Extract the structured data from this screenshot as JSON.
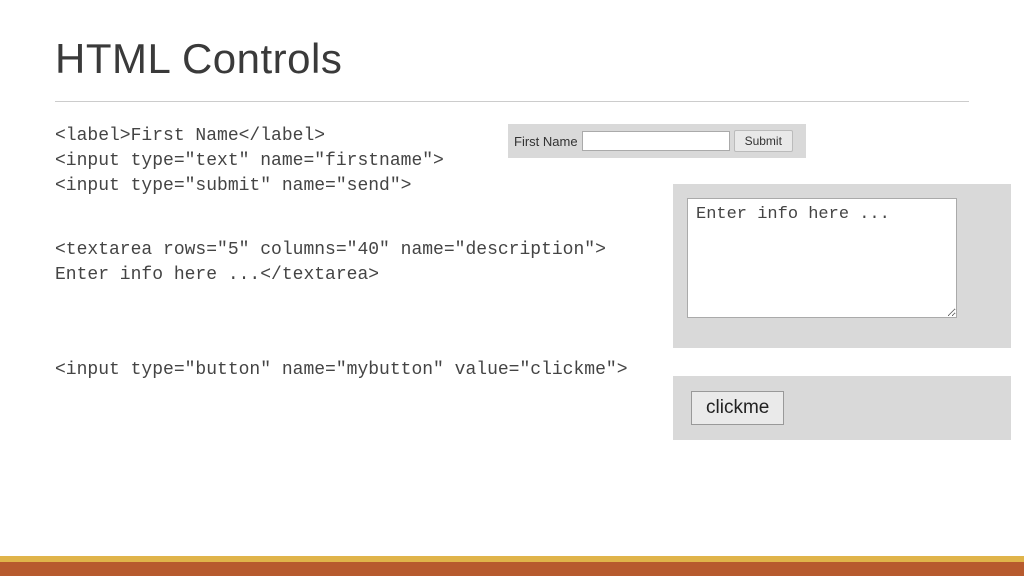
{
  "title": "HTML Controls",
  "code": {
    "block1": "<label>First Name</label>\n<input type=\"text\" name=\"firstname\">\n<input type=\"submit\" name=\"send\">",
    "block2": "<textarea rows=\"5\" columns=\"40\" name=\"description\">\nEnter info here ...</textarea>",
    "block3": "<input type=\"button\" name=\"mybutton\" value=\"clickme\">"
  },
  "demo1": {
    "label": "First Name",
    "submit_label": "Submit"
  },
  "demo2": {
    "textarea_value": "Enter info here ..."
  },
  "demo3": {
    "button_label": "clickme"
  }
}
